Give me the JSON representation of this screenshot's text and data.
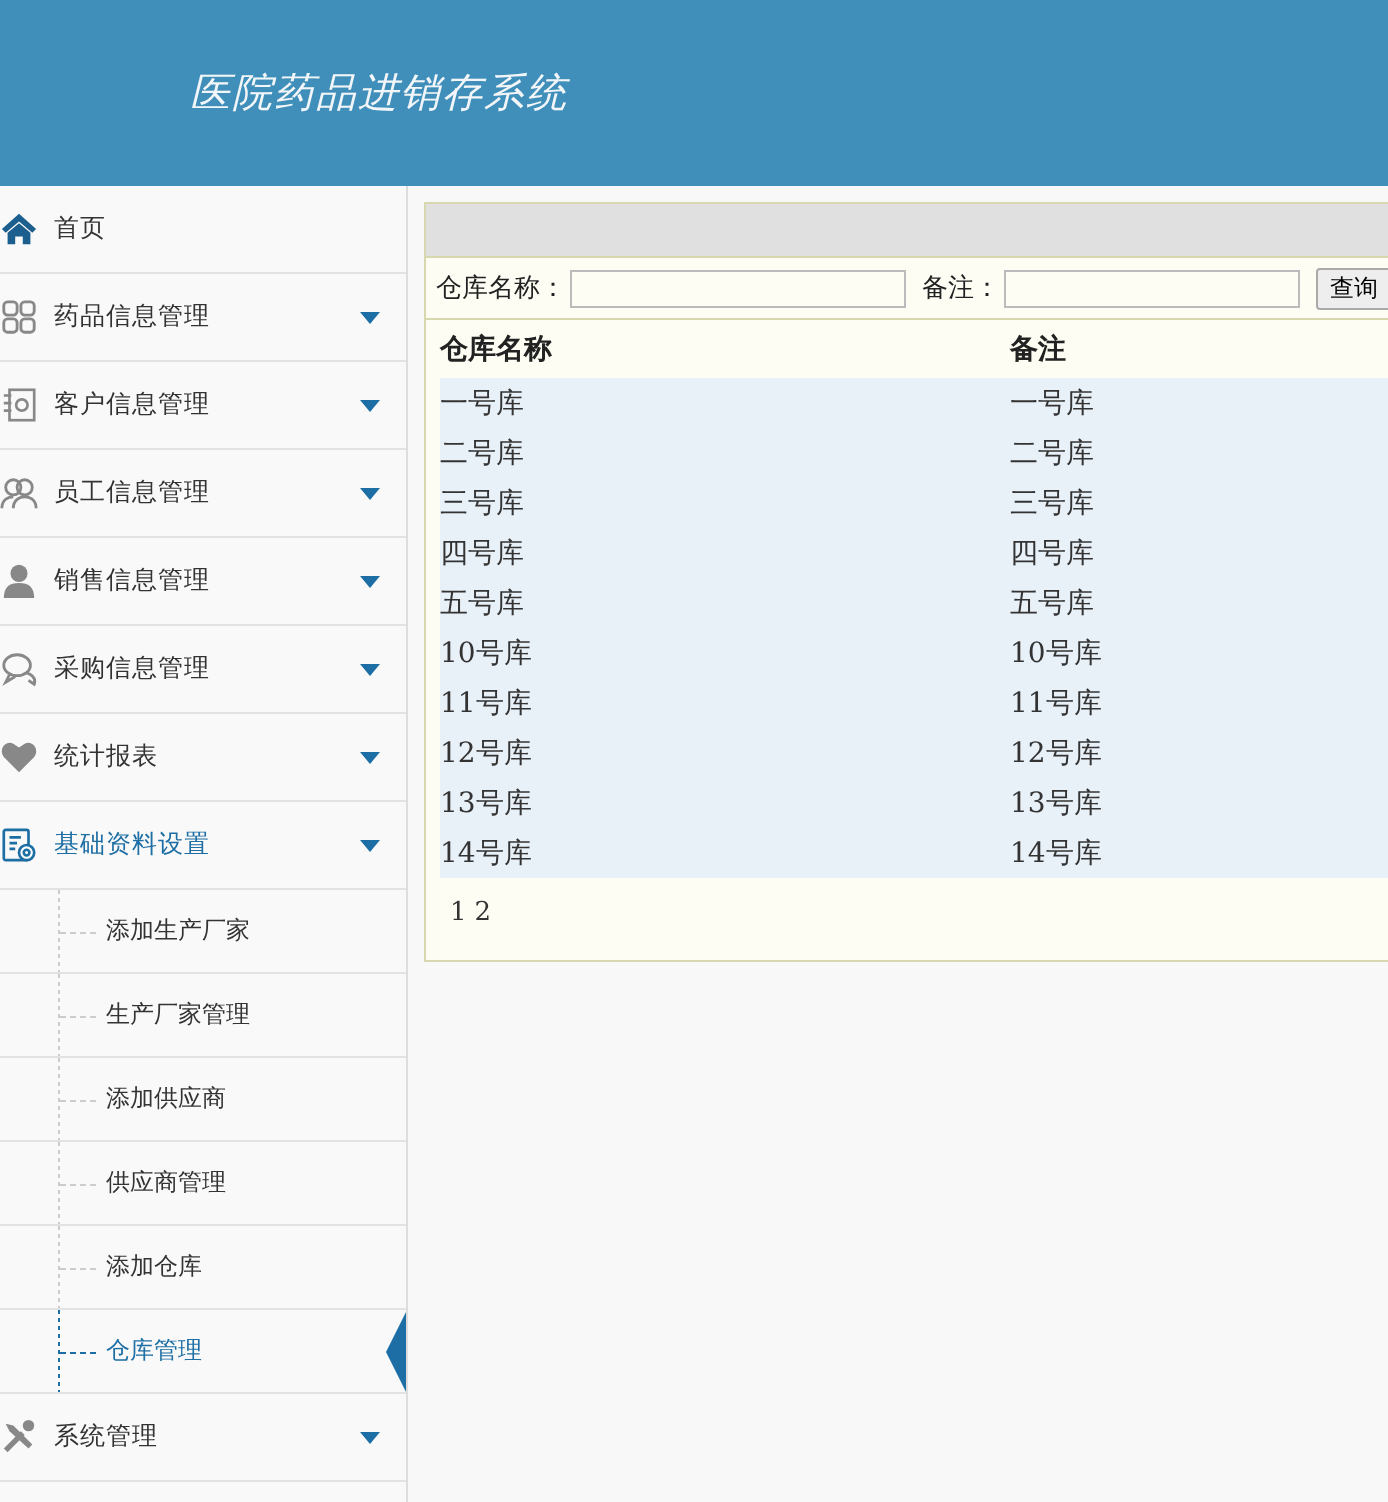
{
  "header": {
    "title": "医院药品进销存系统"
  },
  "sidebar": {
    "items": [
      {
        "label": "首页"
      },
      {
        "label": "药品信息管理",
        "expanded": false
      },
      {
        "label": "客户信息管理",
        "expanded": false
      },
      {
        "label": "员工信息管理",
        "expanded": false
      },
      {
        "label": "销售信息管理",
        "expanded": false
      },
      {
        "label": "采购信息管理",
        "expanded": false
      },
      {
        "label": "统计报表",
        "expanded": false
      },
      {
        "label": "基础资料设置",
        "expanded": true,
        "children": [
          {
            "label": "添加生产厂家",
            "selected": false
          },
          {
            "label": "生产厂家管理",
            "selected": false
          },
          {
            "label": "添加供应商",
            "selected": false
          },
          {
            "label": "供应商管理",
            "selected": false
          },
          {
            "label": "添加仓库",
            "selected": false
          },
          {
            "label": "仓库管理",
            "selected": true
          }
        ]
      },
      {
        "label": "系统管理",
        "expanded": false
      }
    ]
  },
  "search": {
    "fields": [
      {
        "label": "仓库名称："
      },
      {
        "label": "备注："
      }
    ],
    "button": "查询"
  },
  "table": {
    "columns": [
      "仓库名称",
      "备注"
    ],
    "rows": [
      [
        "一号库",
        "一号库"
      ],
      [
        "二号库",
        "二号库"
      ],
      [
        "三号库",
        "三号库"
      ],
      [
        "四号库",
        "四号库"
      ],
      [
        "五号库",
        "五号库"
      ],
      [
        "10号库",
        "10号库"
      ],
      [
        "11号库",
        "11号库"
      ],
      [
        "12号库",
        "12号库"
      ],
      [
        "13号库",
        "13号库"
      ],
      [
        "14号库",
        "14号库"
      ]
    ]
  },
  "pagination": [
    "1",
    "2"
  ]
}
